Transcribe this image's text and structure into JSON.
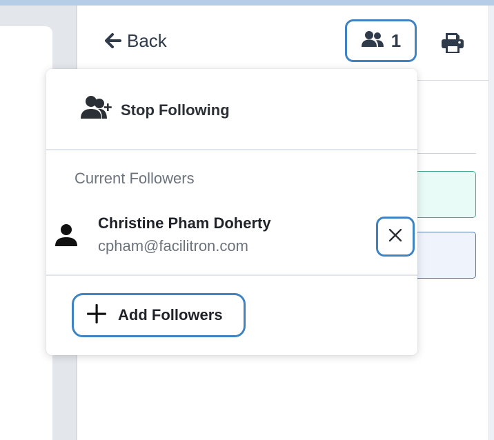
{
  "header": {
    "back_label": "Back",
    "followers_count": "1",
    "icons": {
      "back": "arrow-left-icon",
      "followers": "users-icon",
      "print": "printer-icon"
    }
  },
  "follow_menu": {
    "stop_following_label": "Stop Following",
    "section_title": "Current Followers",
    "followers": [
      {
        "name": "Christine Pham Doherty",
        "email": "cpham@facilitron.com"
      }
    ],
    "add_followers_label": "Add Followers",
    "icons": {
      "stop_following": "user-plus-icon",
      "follower": "person-icon",
      "remove": "close-icon",
      "add": "plus-icon"
    }
  },
  "colors": {
    "focus_ring": "#3f83c2",
    "text_primary": "#1f2329",
    "text_secondary": "#6c737c",
    "top_bar": "#b5cde6"
  }
}
